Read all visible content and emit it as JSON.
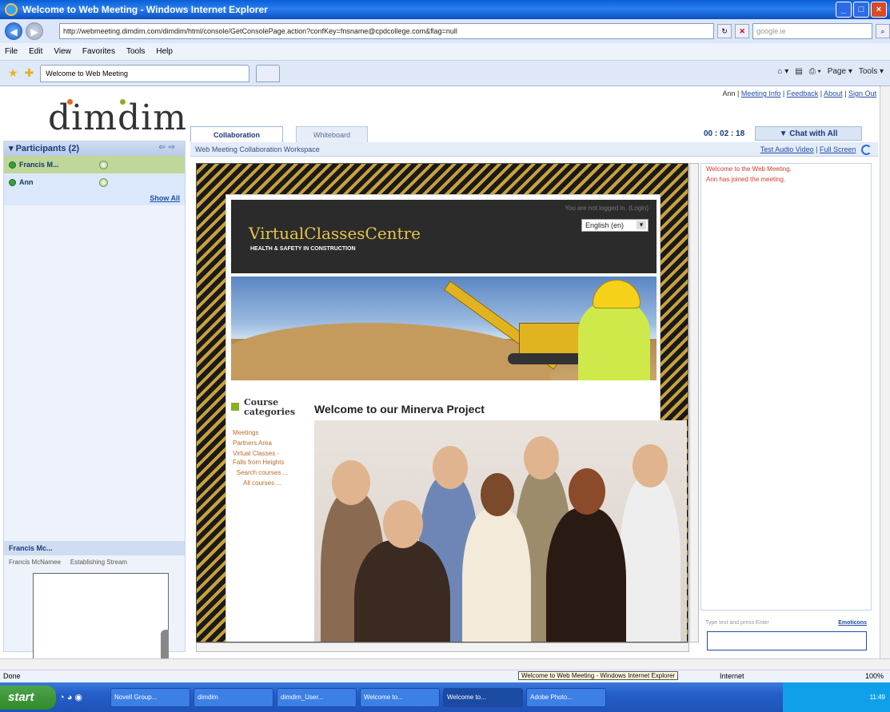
{
  "window": {
    "title": "Welcome to Web Meeting - Windows Internet Explorer",
    "address": "http://webmeeting.dimdim.com/dimdim/html/console/GetConsolePage.action?confKey=fnsname@cpdcollege.com&flag=null",
    "search_placeholder": "google.ie",
    "tab_label": "Welcome to Web Meeting",
    "minimize": "_",
    "maximize": "□",
    "close": "×"
  },
  "menu": [
    "File",
    "Edit",
    "View",
    "Favorites",
    "Tools",
    "Help"
  ],
  "commandbar": {
    "page": "Page ▾",
    "tools": "Tools ▾"
  },
  "app": {
    "logo": "dimdim",
    "toplinks": {
      "user": "Ann |",
      "meeting_info": "Meeting Info",
      "feedback": "Feedback",
      "about": "About",
      "sign_out": "Sign Out"
    },
    "tabs": {
      "collaboration": "Collaboration",
      "whiteboard": "Whiteboard"
    },
    "timer": "00 : 02 : 18",
    "chat_button": "▼  Chat with All",
    "workspace_label": "Web Meeting Collaboration Workspace",
    "test_av": "Test Audio Video",
    "full_screen": "Full Screen"
  },
  "participants": {
    "header": "Participants (2)",
    "list": [
      {
        "name": "Francis M..."
      },
      {
        "name": "Ann"
      }
    ],
    "show_all": "Show All"
  },
  "video": {
    "header": "Francis Mc...",
    "name": "Francis McNamee",
    "status": "Establishing Stream"
  },
  "shared_site": {
    "login_note": "You are not logged in. (Login)",
    "language": "English (en)",
    "title": "VirtualClassesCentre",
    "subtitle": "HEALTH & SAFETY IN CONSTRUCTION",
    "course_header": "Course categories",
    "course_links": [
      "Meetings",
      "Partners Area",
      "Virtual Classes - Falls from Heights"
    ],
    "search_courses": "Search courses ...",
    "all_courses": "All courses ...",
    "welcome": "Welcome to our Minerva Project"
  },
  "chat": {
    "messages": [
      "Welcome to the Web Meeting.",
      "Ann has joined the meeting."
    ],
    "input_hint": "Type text and press Enter",
    "emoticons": "Emoticons"
  },
  "status": {
    "left": "Done",
    "tooltip": "Welcome to Web Meeting - Windows Internet Explorer",
    "zone": "Internet",
    "zoom": "100%"
  },
  "taskbar": {
    "start": "start",
    "tasks": [
      "Novell Group...",
      "dimdim",
      "dimdim_User...",
      "Welcome to...",
      "Welcome to...",
      "Adobe Photo..."
    ],
    "clock": "11:49"
  }
}
